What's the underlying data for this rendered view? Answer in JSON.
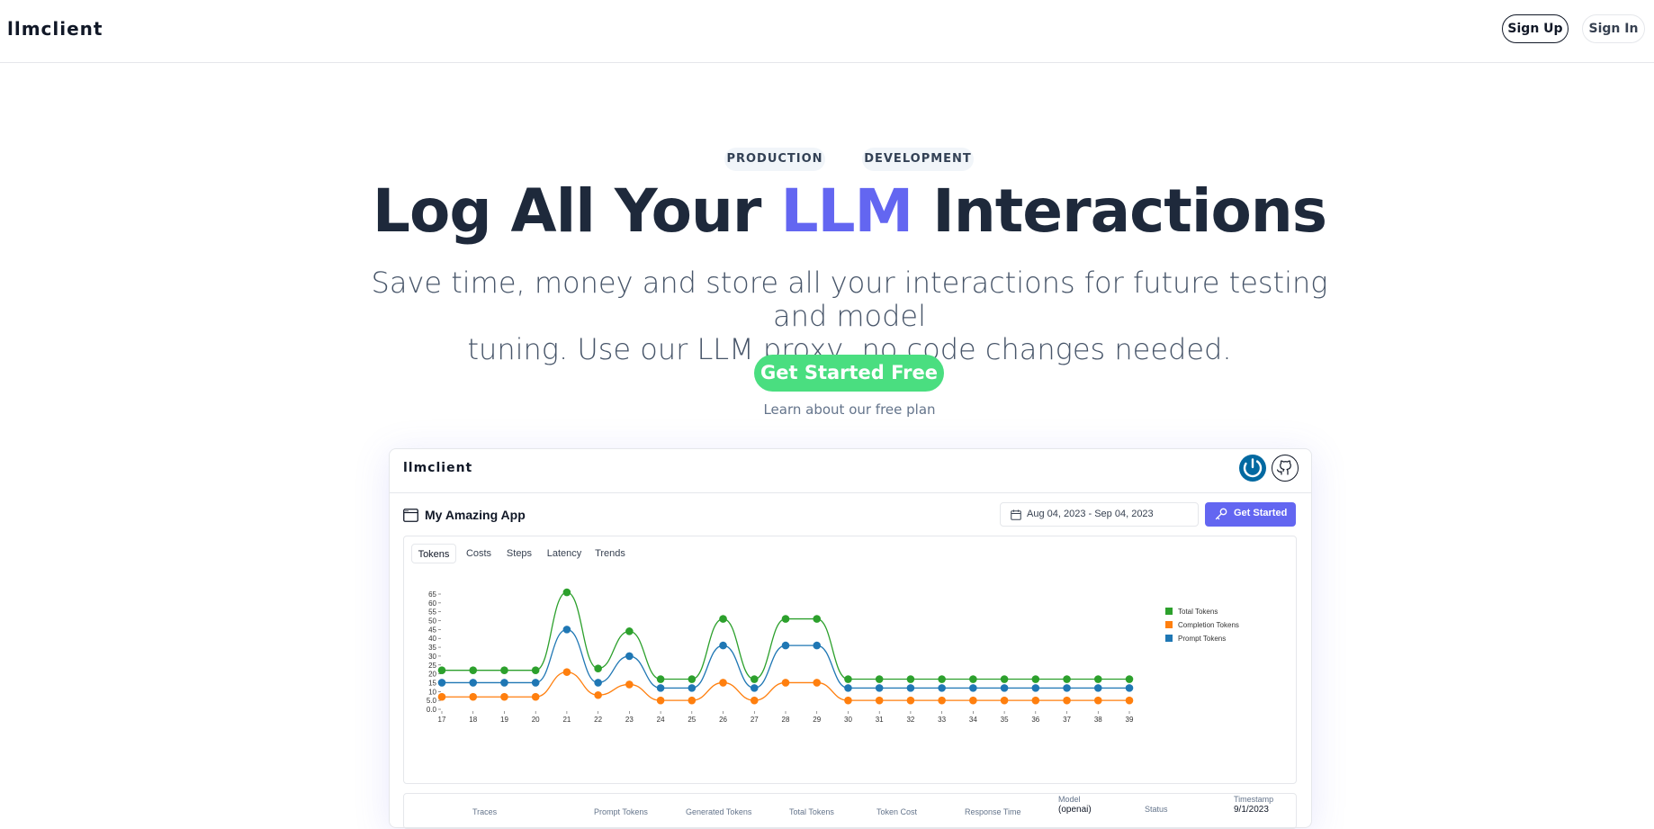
{
  "nav": {
    "brand": "llmclient",
    "sign_up": "Sign Up",
    "sign_in": "Sign In"
  },
  "hero": {
    "tags": [
      "PRODUCTION",
      "DEVELOPMENT"
    ],
    "title_before": "Log All Your ",
    "title_accent": "LLM",
    "title_after": " Interactions",
    "subtitle_line1": "Save time, money and store all your interactions for future testing and model",
    "subtitle_line2": "tuning. Use our LLM proxy, no code changes needed.",
    "cta": "Get Started Free",
    "learn": "Learn about our free plan",
    "accent_color": "#6366f1",
    "cta_color": "#4ade80"
  },
  "preview": {
    "brand": "llmclient",
    "icons": [
      "power-icon",
      "github-icon"
    ],
    "app_name": "My Amazing App",
    "date_range": "Aug 04, 2023 - Sep 04, 2023",
    "get_started": "Get Started",
    "tabs": [
      "Tokens",
      "Costs",
      "Steps",
      "Latency",
      "Trends"
    ],
    "active_tab": "Tokens",
    "table_headers": [
      "Traces",
      "Prompt Tokens",
      "Generated Tokens",
      "Total Tokens",
      "Token Cost",
      "Response Time",
      "Model",
      "Status",
      "Timestamp"
    ],
    "table_partial": {
      "model_value": "(openai)",
      "timestamp_value": "9/1/2023"
    }
  },
  "chart_data": {
    "type": "line",
    "x": [
      "17",
      "18",
      "19",
      "20",
      "21",
      "22",
      "23",
      "24",
      "25",
      "26",
      "27",
      "28",
      "29",
      "30",
      "31",
      "32",
      "33",
      "34",
      "35",
      "36",
      "37",
      "38",
      "39"
    ],
    "y_ticks": [
      "0.0",
      "5.0",
      "10",
      "15",
      "20",
      "25",
      "30",
      "35",
      "40",
      "45",
      "50",
      "55",
      "60",
      "65"
    ],
    "ylim": [
      0,
      65
    ],
    "legend_position": "top-right",
    "series": [
      {
        "name": "Total Tokens",
        "color": "#2ca02c",
        "values": [
          22,
          22,
          22,
          22,
          66,
          23,
          44,
          17,
          17,
          51,
          17,
          51,
          51,
          17,
          17,
          17,
          17,
          17,
          17,
          17,
          17,
          17,
          17
        ]
      },
      {
        "name": "Completion Tokens",
        "color": "#ff7f0e",
        "values": [
          7,
          7,
          7,
          7,
          21,
          8,
          14,
          5,
          5,
          15,
          5,
          15,
          15,
          5,
          5,
          5,
          5,
          5,
          5,
          5,
          5,
          5,
          5
        ]
      },
      {
        "name": "Prompt Tokens",
        "color": "#1f77b4",
        "values": [
          15,
          15,
          15,
          15,
          45,
          15,
          30,
          12,
          12,
          36,
          12,
          36,
          36,
          12,
          12,
          12,
          12,
          12,
          12,
          12,
          12,
          12,
          12
        ]
      }
    ]
  }
}
